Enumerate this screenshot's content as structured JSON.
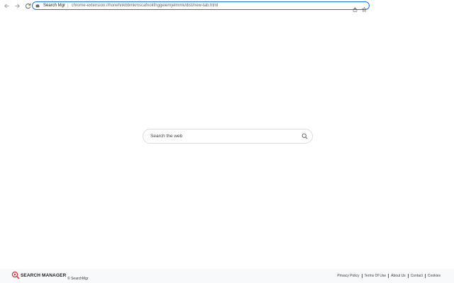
{
  "browser": {
    "site_name": "Search Mgr",
    "separator": "|",
    "url": "chrome-extension://honehnkbbmkmscafnokfnggeiemjelmmk/dist/new-tab.html",
    "icons": {
      "back": "arrow-left-icon",
      "forward": "arrow-right-icon",
      "reload": "reload-icon",
      "extension": "puzzle-icon",
      "share": "share-icon",
      "bookmark": "star-icon"
    },
    "accent_color": "#1a73e8"
  },
  "search": {
    "placeholder": "Search the web",
    "icon": "search-icon"
  },
  "footer": {
    "logo_text": "SEARCH MANAGER",
    "logo_color": "#d32f2f",
    "copyright": "© SearchMgr",
    "links": [
      {
        "label": "Privacy Policy"
      },
      {
        "label": "Terms Of Use"
      },
      {
        "label": "About Us"
      },
      {
        "label": "Contact"
      },
      {
        "label": "Cookies"
      }
    ]
  }
}
